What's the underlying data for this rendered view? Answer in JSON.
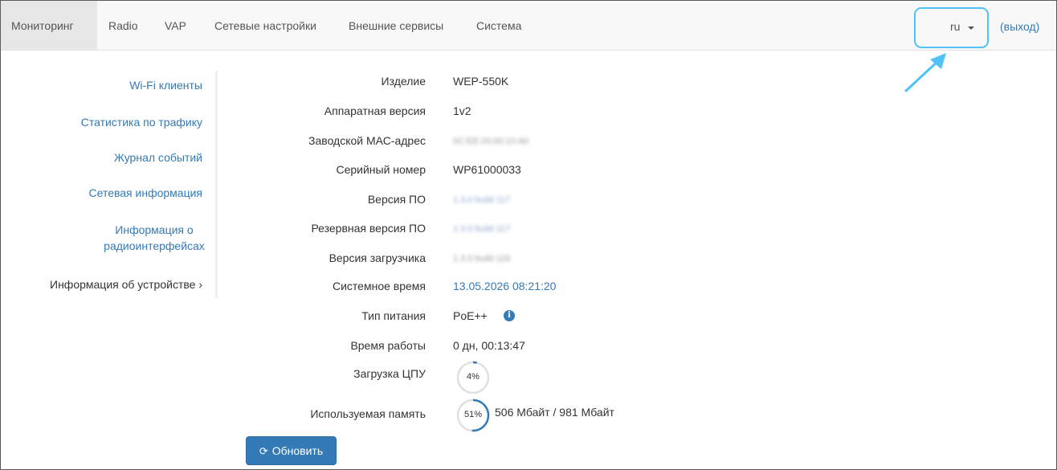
{
  "nav": {
    "tabs": [
      {
        "label": "Мониторинг"
      },
      {
        "label": "Radio"
      },
      {
        "label": "VAP"
      },
      {
        "label": "Сетевые настройки"
      },
      {
        "label": "Внешние сервисы"
      },
      {
        "label": "Система"
      }
    ],
    "language": "ru",
    "logout": "(выход)"
  },
  "sidebar": {
    "items": [
      {
        "label": "Wi-Fi клиенты"
      },
      {
        "label": "Статистика по трафику"
      },
      {
        "label": "Журнал событий"
      },
      {
        "label": "Сетевая информация"
      },
      {
        "label_line1": "Информация о",
        "label_line2": "радиоинтерфейсах"
      },
      {
        "label": "Информация об устройстве",
        "marker": "›"
      }
    ]
  },
  "device": {
    "product": {
      "label": "Изделие",
      "value": "WEP-550K"
    },
    "hw_version": {
      "label": "Аппаратная версия",
      "value": "1v2"
    },
    "mac": {
      "label": "Заводской МАС-адрес",
      "value": "0C:EE:20:00:10:A0"
    },
    "serial": {
      "label": "Серийный номер",
      "value": "WP61000033"
    },
    "fw_version": {
      "label": "Версия ПО",
      "value": "1.3.0 build 117"
    },
    "fw_backup": {
      "label": "Резервная версия ПО",
      "value": "1.3.0 build 117"
    },
    "bootloader": {
      "label": "Версия загрузчика",
      "value": "1.3.0 build 116"
    },
    "system_time": {
      "label": "Системное время",
      "value": "13.05.2026 08:21:20"
    },
    "power": {
      "label": "Тип питания",
      "value": "PoE++"
    },
    "uptime": {
      "label": "Время работы",
      "value": "0 дн, 00:13:47"
    },
    "cpu": {
      "label": "Загрузка ЦПУ",
      "percent": 4,
      "text": "4%"
    },
    "memory": {
      "label": "Используемая память",
      "percent": 51,
      "text": "51%",
      "detail": "506 Мбайт / 981 Мбайт"
    }
  },
  "actions": {
    "refresh": "Обновить"
  },
  "colors": {
    "accent": "#337ab7",
    "gauge_track": "#e0e0e0",
    "annotation": "#4fc3f7"
  }
}
